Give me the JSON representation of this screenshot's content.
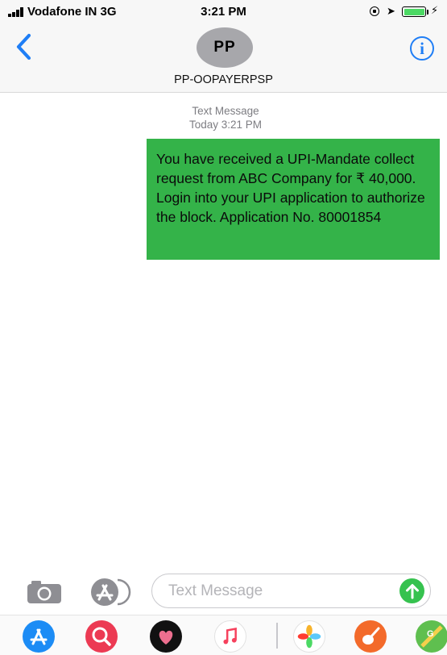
{
  "status_bar": {
    "carrier": "Vodafone IN  3G",
    "time": "3:21 PM"
  },
  "header": {
    "avatar_initials": "PP",
    "contact_name": "PP-OOPAYERPSP",
    "info_symbol": "i"
  },
  "conversation": {
    "meta_label": "Text Message",
    "meta_time": "Today 3:21 PM",
    "messages": [
      {
        "direction": "incoming",
        "text": "You have received a UPI-Mandate collect request from ABC Company for ₹ 40,000. Login into your UPI application to authorize the block. Application No. 80001854"
      }
    ]
  },
  "compose": {
    "placeholder": "Text Message",
    "value": ""
  },
  "app_drawer": {
    "icons": [
      "app-store-icon",
      "search-images-icon",
      "digital-touch-icon",
      "music-icon",
      "photos-icon",
      "garageband-icon",
      "maps-icon"
    ]
  },
  "colors": {
    "accent_blue": "#1f7ef6",
    "bubble_green": "#34b349",
    "send_green": "#36c24f",
    "header_gray": "#f7f7f7"
  }
}
